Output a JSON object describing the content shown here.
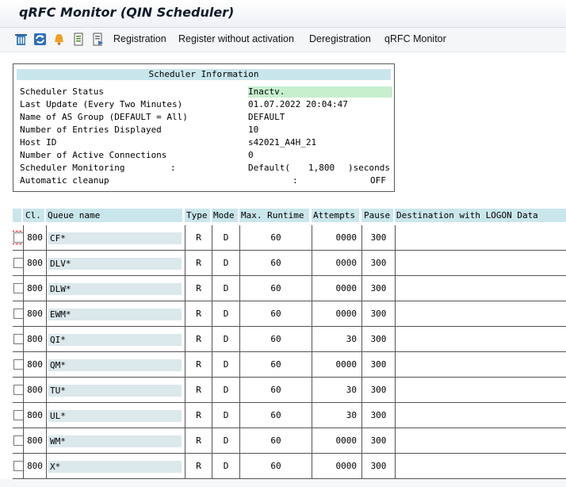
{
  "window": {
    "title": "qRFC Monitor (QIN Scheduler)"
  },
  "toolbar": {
    "icons": [
      "delete-icon",
      "refresh-icon",
      "bell-icon",
      "document-icon",
      "document-list-icon"
    ],
    "buttons": [
      "Registration",
      "Register without activation",
      "Deregistration",
      "qRFC Monitor"
    ]
  },
  "scheduler_info": {
    "title": "Scheduler Information",
    "rows": [
      {
        "label": "Scheduler Status",
        "value": "Inactv."
      },
      {
        "label": "Last Update (Every Two Minutes)",
        "value": "01.07.2022 20:04:47"
      },
      {
        "label": "Name of AS Group (DEFAULT = All)",
        "value": "DEFAULT"
      },
      {
        "label": "Number of Entries Displayed",
        "value": "10"
      },
      {
        "label": "Host ID",
        "value": "s42021_A4H_21"
      },
      {
        "label": "Number of Active Connections",
        "value": "0"
      },
      {
        "label": "Scheduler Monitoring",
        "sep": ":",
        "value": "Default(",
        "value2": "1,800",
        "value3": ")seconds"
      },
      {
        "label": "Automatic cleanup",
        "sep": ":",
        "value": "OFF"
      }
    ]
  },
  "table": {
    "headers": [
      "Cl.",
      "Queue name",
      "Type",
      "Mode",
      "Max. Runtime",
      "Attempts",
      "Pause",
      "Destination with LOGON Data"
    ],
    "rows": [
      {
        "client": "800",
        "queue": "CF*",
        "type": "R",
        "mode": "D",
        "runtime": "60",
        "attempts": "0000",
        "pause": "300"
      },
      {
        "client": "800",
        "queue": "DLV*",
        "type": "R",
        "mode": "D",
        "runtime": "60",
        "attempts": "0000",
        "pause": "300"
      },
      {
        "client": "800",
        "queue": "DLW*",
        "type": "R",
        "mode": "D",
        "runtime": "60",
        "attempts": "0000",
        "pause": "300"
      },
      {
        "client": "800",
        "queue": "EWM*",
        "type": "R",
        "mode": "D",
        "runtime": "60",
        "attempts": "0000",
        "pause": "300"
      },
      {
        "client": "800",
        "queue": "QI*",
        "type": "R",
        "mode": "D",
        "runtime": "60",
        "attempts": "30",
        "pause": "300"
      },
      {
        "client": "800",
        "queue": "QM*",
        "type": "R",
        "mode": "D",
        "runtime": "60",
        "attempts": "0000",
        "pause": "300"
      },
      {
        "client": "800",
        "queue": "TU*",
        "type": "R",
        "mode": "D",
        "runtime": "60",
        "attempts": "30",
        "pause": "300"
      },
      {
        "client": "800",
        "queue": "UL*",
        "type": "R",
        "mode": "D",
        "runtime": "60",
        "attempts": "30",
        "pause": "300"
      },
      {
        "client": "800",
        "queue": "WM*",
        "type": "R",
        "mode": "D",
        "runtime": "60",
        "attempts": "0000",
        "pause": "300"
      },
      {
        "client": "800",
        "queue": "X*",
        "type": "R",
        "mode": "D",
        "runtime": "60",
        "attempts": "0000",
        "pause": "300"
      }
    ]
  }
}
